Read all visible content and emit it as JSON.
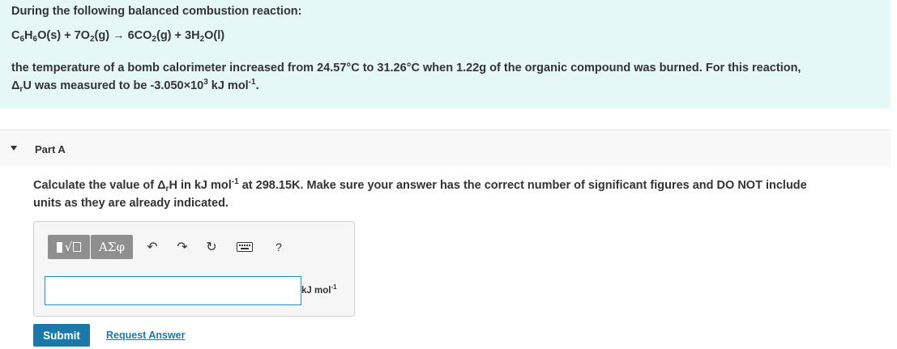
{
  "problem": {
    "intro": "During the following balanced combustion reaction:",
    "reaction": {
      "c": "C",
      "c_sub": "6",
      "h": "H",
      "h_sub": "6",
      "rest1": "O(s) + 7O",
      "o2_sub": "2",
      "rest2": "(g) → 6CO",
      "co2_sub": "2",
      "rest3": "(g) + 3H",
      "h2o_sub": "2",
      "rest4": "O(l)"
    },
    "line3": "the temperature of a bomb calorimeter increased from 24.57°C to 31.26°C when 1.22g of the organic compound was burned. For this reaction,",
    "line4": {
      "delta": "Δ",
      "r_sub": "r",
      "text1": "U was measured to be -3.050×10",
      "exp": "3",
      "text2": " kJ mol",
      "neg1": "-1",
      "end": "."
    }
  },
  "part": {
    "label": "Part A"
  },
  "question": {
    "t1": "Calculate the value of Δ",
    "r_sub": "r",
    "t2": "H in kJ mol",
    "neg1": "-1",
    "t3": " at 298.15K. Make sure your answer has the correct number of significant figures and DO NOT include",
    "line2": "units as they are already indicated."
  },
  "toolbar": {
    "template_icon": "template-radical-icon",
    "template_glyph": "√",
    "greek_label": "ΑΣφ",
    "undo_icon": "undo-icon",
    "undo_glyph": "↶",
    "redo_icon": "redo-icon",
    "redo_glyph": "↷",
    "reset_icon": "reset-icon",
    "reset_glyph": "↻",
    "keyboard_icon": "keyboard-icon",
    "help_label": "?"
  },
  "answer": {
    "value": "",
    "units": "kJ mol",
    "units_exp": "-1"
  },
  "actions": {
    "submit": "Submit",
    "request": "Request Answer"
  },
  "colors": {
    "problem_bg": "#e6f7f7",
    "accent": "#1c78a8",
    "toolbar_btn": "#8f8f8f"
  }
}
